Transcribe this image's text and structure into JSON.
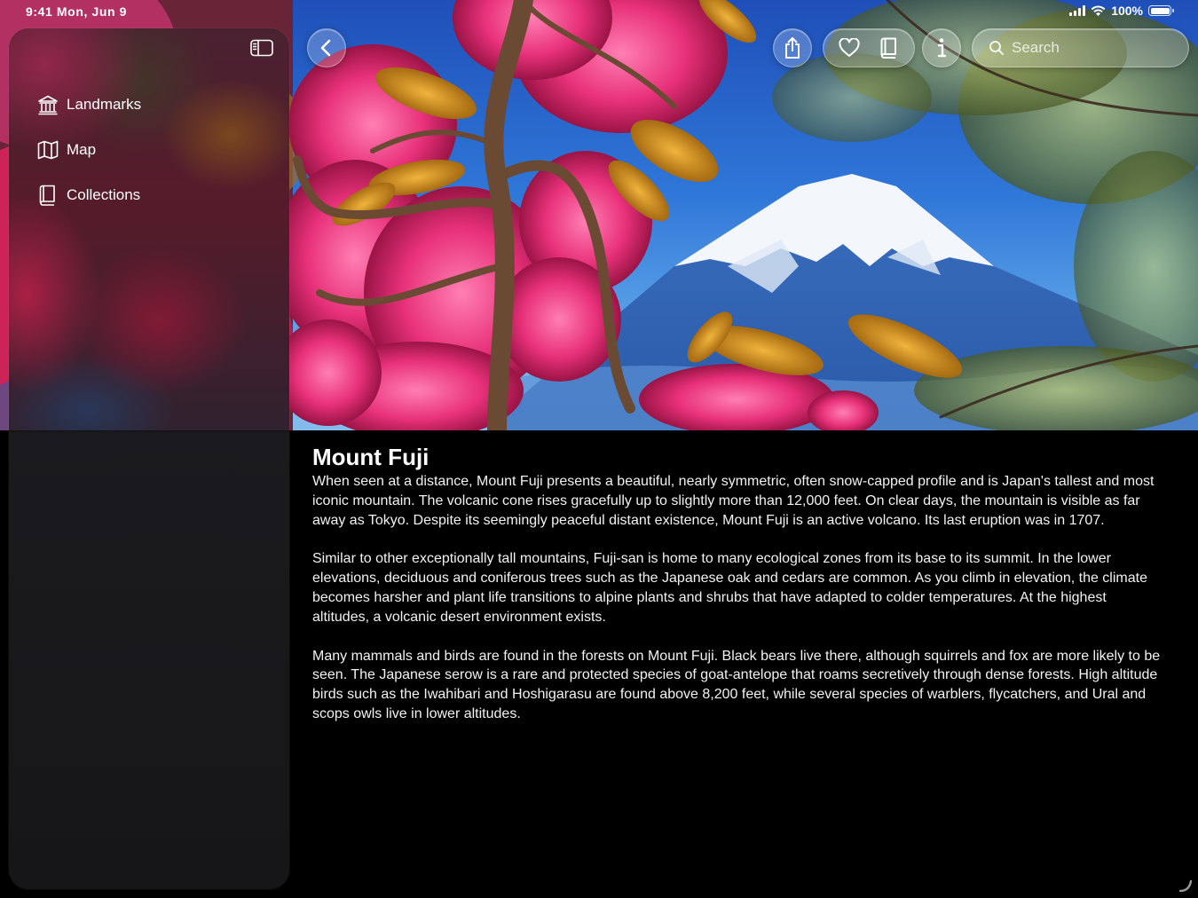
{
  "status_bar": {
    "time": "9:41",
    "date": "Mon, Jun 9",
    "battery": "100%"
  },
  "sidebar": {
    "toggle_icon": "sidebar-left-icon",
    "items": [
      {
        "label": "Landmarks",
        "icon": "building-columns-icon"
      },
      {
        "label": "Map",
        "icon": "map-icon"
      },
      {
        "label": "Collections",
        "icon": "book-icon"
      }
    ]
  },
  "toolbar": {
    "back_icon": "chevron-left-icon",
    "share_icon": "share-icon",
    "favorite_icon": "heart-icon",
    "collection_icon": "book-icon",
    "info_icon": "info-icon",
    "search_placeholder": "Search"
  },
  "article": {
    "title": "Mount Fuji",
    "paragraphs": [
      "When seen at a distance, Mount Fuji presents a beautiful, nearly symmetric, often snow-capped profile and is Japan's tallest and most iconic mountain. The volcanic cone rises gracefully up to slightly more than 12,000 feet. On clear days, the mountain is visible as far away as Tokyo. Despite its seemingly peaceful distant existence, Mount Fuji is an active volcano. Its last eruption was in 1707.",
      "Similar to other exceptionally tall mountains, Fuji-san is home to many ecological zones from its base to its summit. In the lower elevations, deciduous and coniferous trees such as the Japanese oak and cedars are common. As you climb in elevation, the climate becomes harsher and plant life transitions to alpine plants and shrubs that have adapted to colder temperatures. At the highest altitudes, a volcanic desert environment exists.",
      "Many mammals and birds are found in the forests on Mount Fuji. Black bears live there, although squirrels and fox are more likely to be seen. The Japanese serow is a rare and protected species of goat-antelope that roams secretively through dense forests. High altitude birds such as the Iwahibari and Hoshigarasu are found above 8,200 feet, while several species of warblers, flycatchers, and Ural and scops owls live in lower altitudes."
    ]
  },
  "colors": {
    "accent": "#0a84ff",
    "background": "#000000",
    "sidebar": "#1b1b1f"
  }
}
